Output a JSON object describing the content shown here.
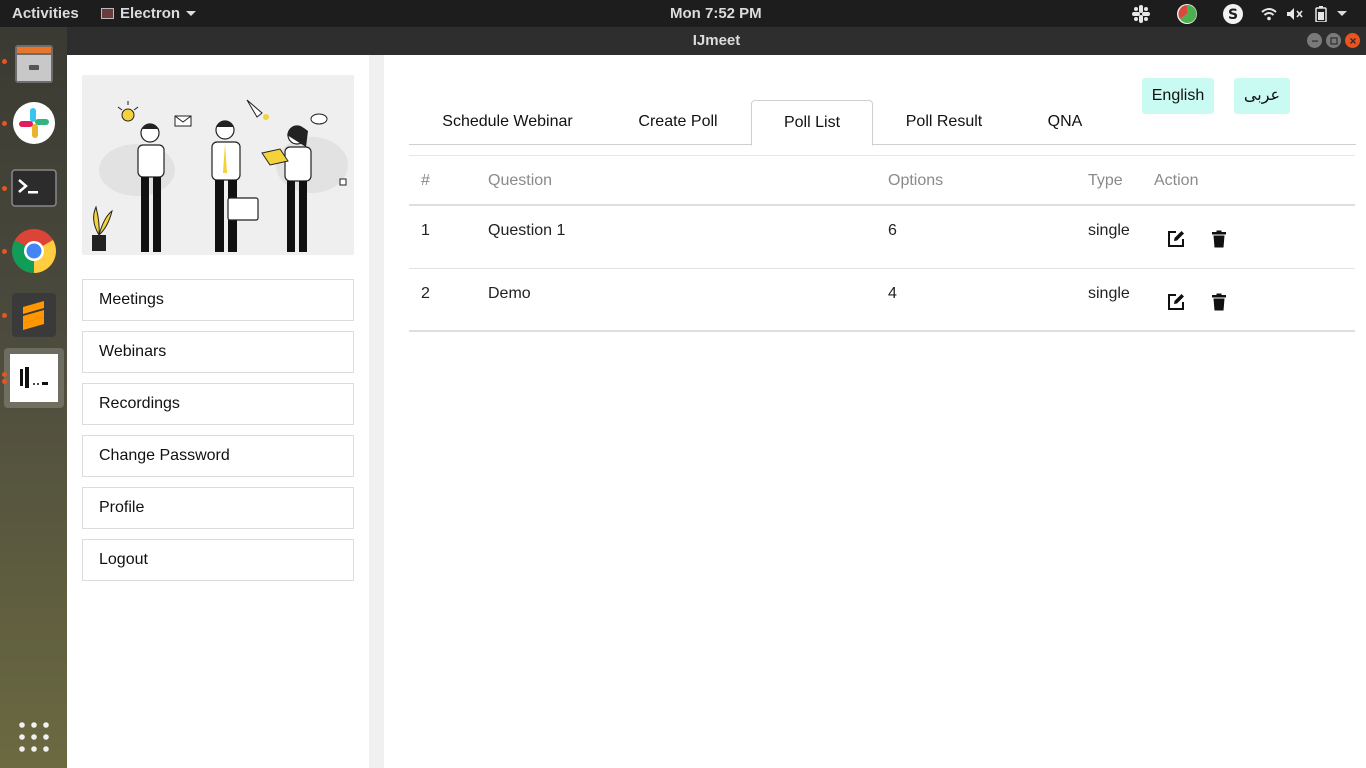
{
  "topbar": {
    "activities": "Activities",
    "app_menu": "Electron",
    "clock": "Mon  7:52 PM"
  },
  "dock": {
    "items": [
      {
        "name": "files",
        "icon": "file-cabinet-icon"
      },
      {
        "name": "slack",
        "icon": "slack-icon"
      },
      {
        "name": "terminal",
        "icon": "terminal-icon"
      },
      {
        "name": "chrome",
        "icon": "chrome-icon"
      },
      {
        "name": "sublime",
        "icon": "sublime-icon"
      },
      {
        "name": "ijmeet",
        "icon": "ijmeet-logo-icon"
      },
      {
        "name": "show-apps",
        "icon": "grid-icon"
      }
    ]
  },
  "window": {
    "title": "IJmeet"
  },
  "sidebar": {
    "menu": [
      {
        "label": "Meetings"
      },
      {
        "label": "Webinars"
      },
      {
        "label": "Recordings"
      },
      {
        "label": "Change Password"
      },
      {
        "label": "Profile"
      },
      {
        "label": "Logout"
      }
    ]
  },
  "language": {
    "english": "English",
    "arabic": "عربى"
  },
  "tabs": [
    {
      "label": "Schedule Webinar"
    },
    {
      "label": "Create Poll"
    },
    {
      "label": "Poll List",
      "active": true
    },
    {
      "label": "Poll Result"
    },
    {
      "label": "QNA"
    }
  ],
  "table": {
    "headers": {
      "num": "#",
      "question": "Question",
      "options": "Options",
      "type": "Type",
      "action": "Action"
    },
    "rows": [
      {
        "num": "1",
        "question": "Question 1",
        "options": "6",
        "type": "single"
      },
      {
        "num": "2",
        "question": "Demo",
        "options": "4",
        "type": "single"
      }
    ]
  },
  "colors": {
    "lang_button_bg": "#c9fbf3",
    "close_button": "#e95420",
    "active_dot": "#e95420"
  }
}
